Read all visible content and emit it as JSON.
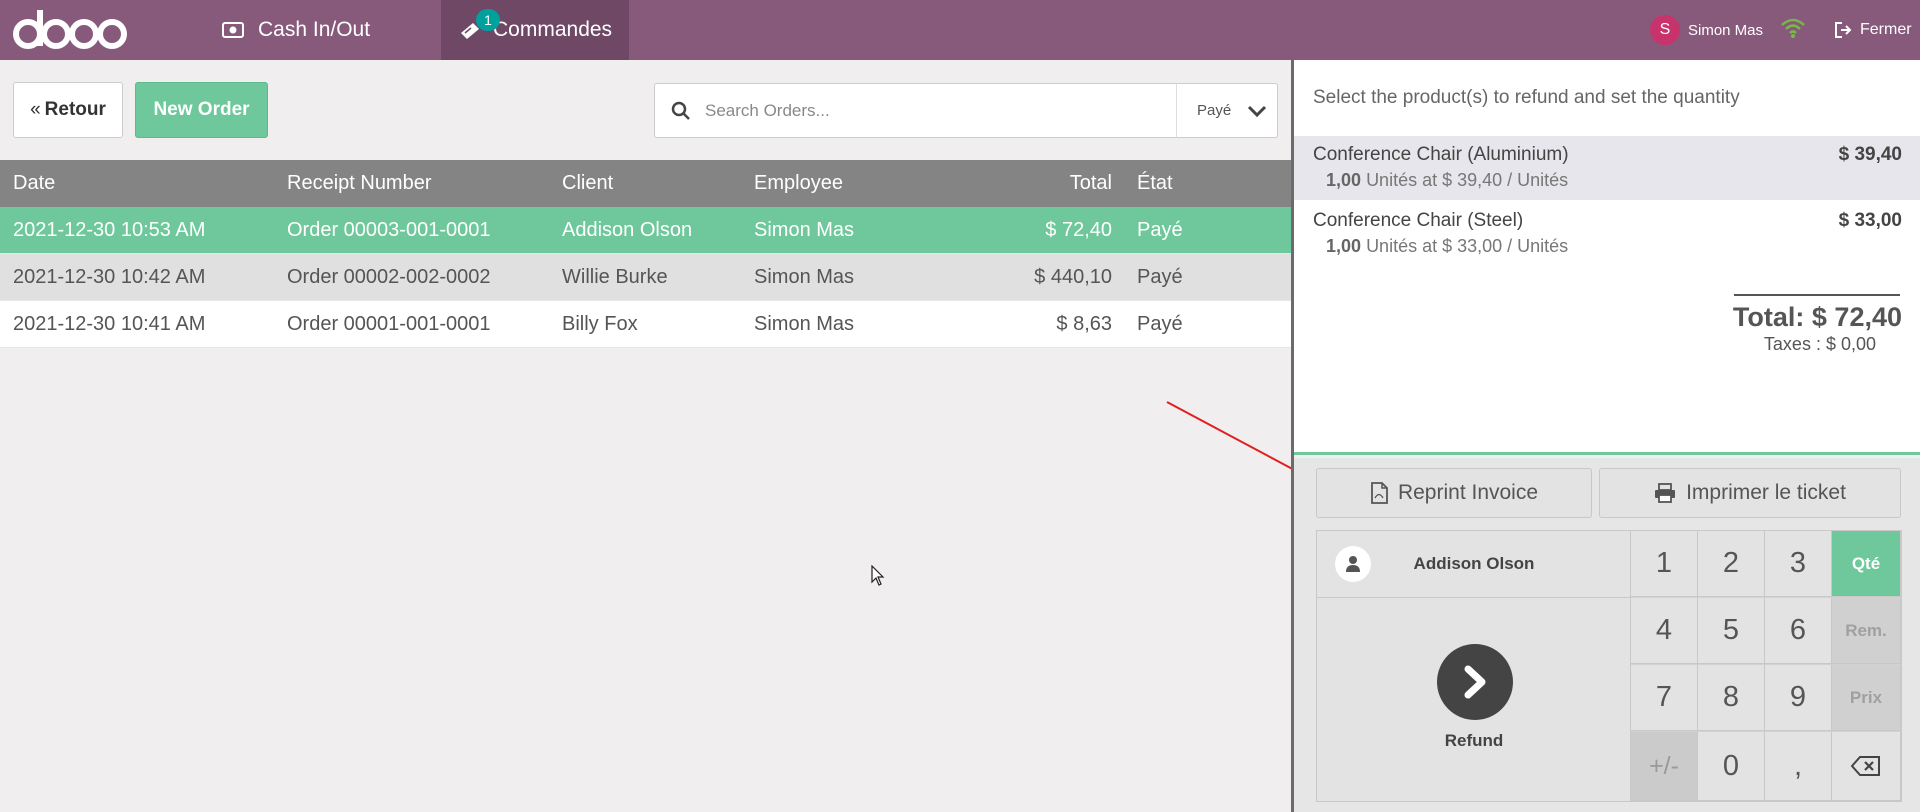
{
  "brand": {
    "logo_text": "odoo"
  },
  "topbar": {
    "cash_label": "Cash In/Out",
    "orders_label": "Commandes",
    "orders_badge": "1",
    "user_initial": "S",
    "user_name": "Simon Mas",
    "close_label": "Fermer"
  },
  "toolbar": {
    "back_label": "Retour",
    "new_order_label": "New Order",
    "search_placeholder": "Search Orders...",
    "filter_value": "Payé"
  },
  "orders_table": {
    "headers": [
      "Date",
      "Receipt Number",
      "Client",
      "Employee",
      "Total",
      "État"
    ],
    "rows": [
      {
        "date": "2021-12-30 10:53 AM",
        "receipt": "Order 00003-001-0001",
        "client": "Addison Olson",
        "employee": "Simon Mas",
        "total": "$ 72,40",
        "state": "Payé"
      },
      {
        "date": "2021-12-30 10:42 AM",
        "receipt": "Order 00002-002-0002",
        "client": "Willie Burke",
        "employee": "Simon Mas",
        "total": "$ 440,10",
        "state": "Payé"
      },
      {
        "date": "2021-12-30 10:41 AM",
        "receipt": "Order 00001-001-0001",
        "client": "Billy Fox",
        "employee": "Simon Mas",
        "total": "$ 8,63",
        "state": "Payé"
      }
    ]
  },
  "order_detail": {
    "hint": "Select the product(s) to refund and set the quantity",
    "lines": [
      {
        "name": "Conference Chair (Aluminium)",
        "price": "$ 39,40",
        "qty": "1,00",
        "info": "Unités at $ 39,40 / Unités"
      },
      {
        "name": "Conference Chair (Steel)",
        "price": "$ 33,00",
        "qty": "1,00",
        "info": "Unités at $ 33,00 / Unités"
      }
    ],
    "total": "Total: $ 72,40",
    "taxes": "Taxes : $ 0,00"
  },
  "actions": {
    "reprint_label": "Reprint Invoice",
    "print_label": "Imprimer le ticket",
    "customer_name": "Addison Olson",
    "refund_label": "Refund"
  },
  "numpad": {
    "k1": "1",
    "k2": "2",
    "k3": "3",
    "k4": "4",
    "k5": "5",
    "k6": "6",
    "k7": "7",
    "k8": "8",
    "k9": "9",
    "sign": "+/-",
    "k0": "0",
    "comma": ",",
    "mode_qty": "Qté",
    "mode_disc": "Rem.",
    "mode_price": "Prix"
  },
  "colors": {
    "topbar": "#875a7b",
    "active_tab": "#6e4865",
    "accent_green": "#6ec89b",
    "badge": "#00a09d",
    "avatar": "#c8336b"
  },
  "icons": {
    "cash": "money-icon",
    "orders": "receipt-icon",
    "wifi": "wifi-icon",
    "close": "sign-out-icon",
    "search": "search-icon",
    "reprint": "pdf-file-icon",
    "print": "printer-icon",
    "customer": "user-icon",
    "refund": "chevron-right-icon",
    "backspace": "backspace-icon"
  }
}
